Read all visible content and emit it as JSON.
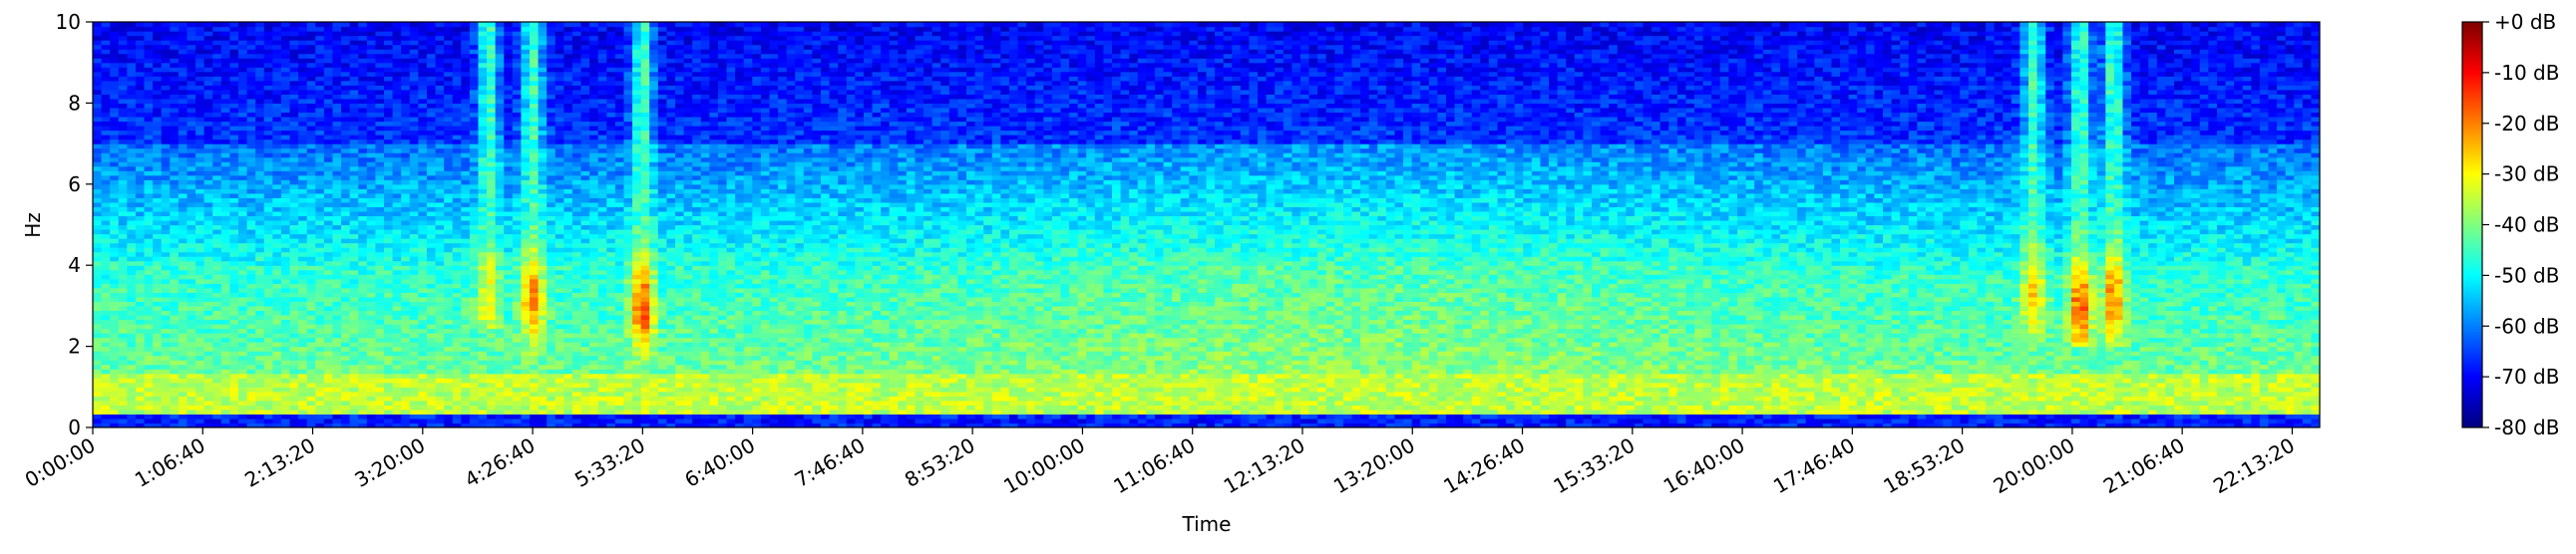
{
  "chart_data": {
    "type": "heatmap",
    "title": "",
    "xlabel": "Time",
    "ylabel": "Hz",
    "x_unit": "seconds (H:MM:SS)",
    "xlim": [
      0,
      81000
    ],
    "ylim": [
      0,
      10
    ],
    "x_tick_labels": [
      "0:00:00",
      "1:06:40",
      "2:13:20",
      "3:20:00",
      "4:26:40",
      "5:33:20",
      "6:40:00",
      "7:46:40",
      "8:53:20",
      "10:00:00",
      "11:06:40",
      "12:13:20",
      "13:20:00",
      "14:26:40",
      "15:33:20",
      "16:40:00",
      "17:46:40",
      "18:53:20",
      "20:00:00",
      "21:06:40",
      "22:13:20"
    ],
    "x_tick_values": [
      0,
      4000,
      8000,
      12000,
      16000,
      20000,
      24000,
      28000,
      32000,
      36000,
      40000,
      44000,
      48000,
      52000,
      56000,
      60000,
      64000,
      68000,
      72000,
      76000,
      80000
    ],
    "y_ticks": [
      0,
      2,
      4,
      6,
      8,
      10
    ],
    "colorbar": {
      "label_values": [
        0,
        -10,
        -20,
        -30,
        -40,
        -50,
        -60,
        -70,
        -80
      ],
      "tick_labels": [
        "+0 dB",
        "-10 dB",
        "-20 dB",
        "-30 dB",
        "-40 dB",
        "-50 dB",
        "-60 dB",
        "-70 dB",
        "-80 dB"
      ],
      "range": [
        -80,
        0
      ],
      "colormap": "jet",
      "colors": [
        "#00007f",
        "#0000ff",
        "#007fff",
        "#00ffff",
        "#7fff7f",
        "#ffff00",
        "#ff7f00",
        "#ff0000",
        "#7f0000"
      ]
    },
    "grid": false,
    "background_level_db": -60,
    "low_frequency_band": {
      "hz_range": [
        0.6,
        1.3
      ],
      "db": -35
    },
    "mid_band": {
      "hz_range": [
        1.5,
        4.0
      ],
      "db": -45
    },
    "events": [
      {
        "time": 14400,
        "hz_range": [
          2.5,
          10
        ],
        "peak_hz": 3.2,
        "db": -30
      },
      {
        "time": 16000,
        "hz_range": [
          1.5,
          10
        ],
        "peak_hz": 3.2,
        "db": -20
      },
      {
        "time": 20000,
        "hz_range": [
          1.0,
          10
        ],
        "peak_hz": 3.0,
        "db": -15
      },
      {
        "time": 70600,
        "hz_range": [
          2.0,
          10
        ],
        "peak_hz": 3.3,
        "db": -25
      },
      {
        "time": 72300,
        "hz_range": [
          2.0,
          10
        ],
        "peak_hz": 3.0,
        "db": -15
      },
      {
        "time": 73500,
        "hz_range": [
          2.0,
          10
        ],
        "peak_hz": 3.2,
        "db": -20
      }
    ]
  }
}
